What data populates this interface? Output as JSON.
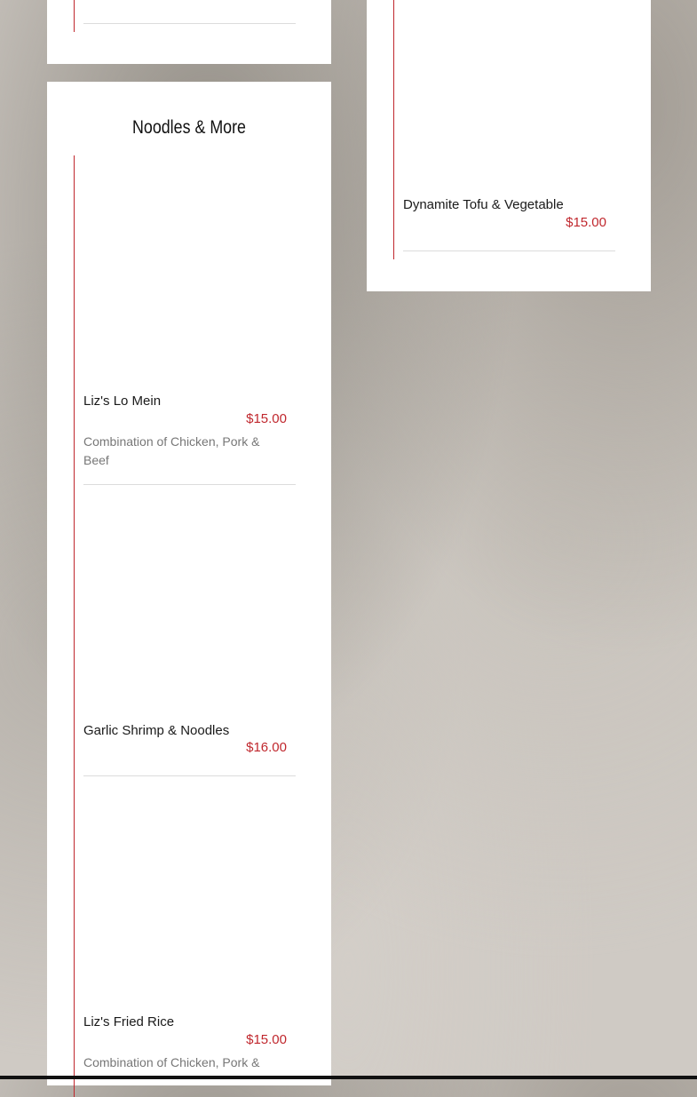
{
  "left_column": {
    "section_title": "Noodles & More",
    "items": [
      {
        "name": "Liz's Lo Mein",
        "price": "$15.00",
        "description": "Combination of Chicken, Pork & Beef"
      },
      {
        "name": "Garlic Shrimp & Noodles",
        "price": "$16.00",
        "description": ""
      },
      {
        "name": "Liz's Fried Rice",
        "price": "$15.00",
        "description": "Combination of Chicken, Pork &"
      }
    ]
  },
  "right_column": {
    "items": [
      {
        "name": "Dynamite Tofu & Vegetable",
        "price": "$15.00"
      }
    ]
  },
  "colors": {
    "accent": "#c0272d",
    "card": "#ffffff",
    "text": "#1a1a1a",
    "muted": "#777777"
  }
}
